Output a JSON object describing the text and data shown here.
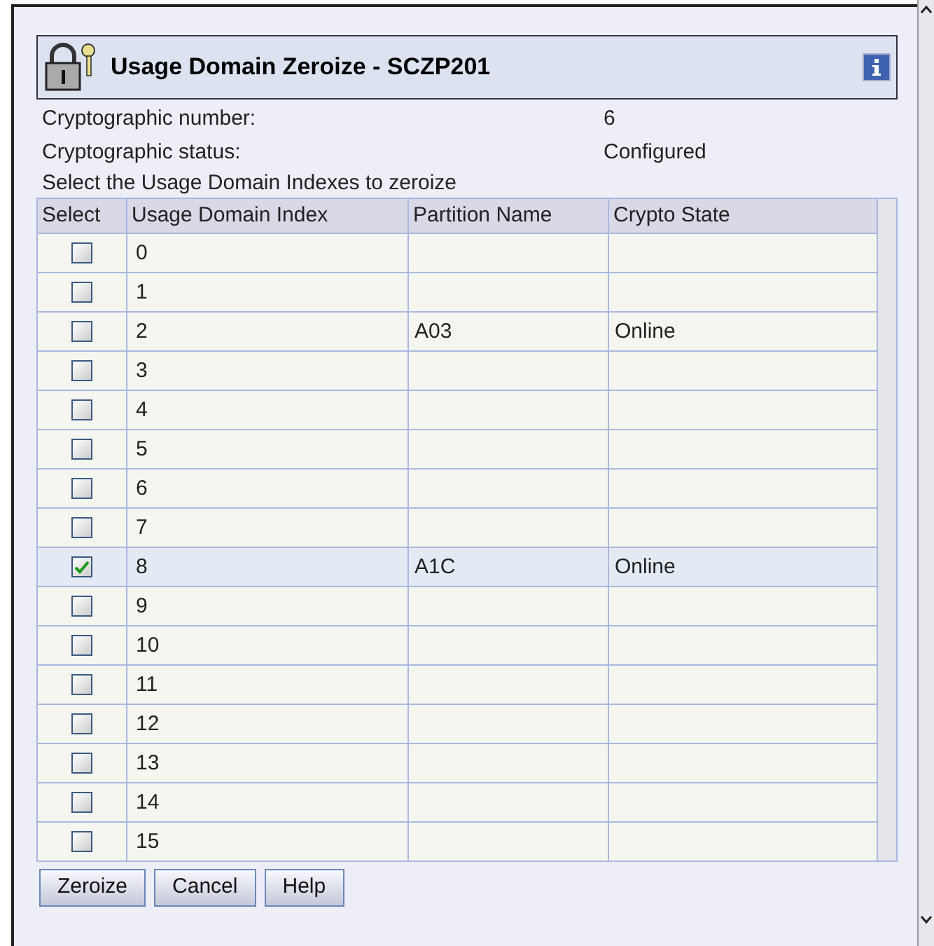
{
  "dialog": {
    "title": "Usage Domain Zeroize - SCZP201"
  },
  "info": [
    {
      "label": "Cryptographic number:",
      "value": "6"
    },
    {
      "label": "Cryptographic status:",
      "value": "Configured"
    }
  ],
  "instruction": "Select the Usage Domain Indexes to zeroize",
  "table": {
    "columns": [
      "Select",
      "Usage Domain Index",
      "Partition Name",
      "Crypto State"
    ],
    "rows": [
      {
        "checked": false,
        "index": "0"
      },
      {
        "checked": false,
        "index": "1"
      },
      {
        "checked": false,
        "index": "2",
        "partition": "A03",
        "state": "Online"
      },
      {
        "checked": false,
        "index": "3"
      },
      {
        "checked": false,
        "index": "4"
      },
      {
        "checked": false,
        "index": "5"
      },
      {
        "checked": false,
        "index": "6"
      },
      {
        "checked": false,
        "index": "7"
      },
      {
        "checked": true,
        "index": "8",
        "partition": "A1C",
        "state": "Online"
      },
      {
        "checked": false,
        "index": "9"
      },
      {
        "checked": false,
        "index": "10"
      },
      {
        "checked": false,
        "index": "11"
      },
      {
        "checked": false,
        "index": "12"
      },
      {
        "checked": false,
        "index": "13"
      },
      {
        "checked": false,
        "index": "14"
      },
      {
        "checked": false,
        "index": "15"
      }
    ]
  },
  "buttons": [
    "Zeroize",
    "Cancel",
    "Help"
  ]
}
